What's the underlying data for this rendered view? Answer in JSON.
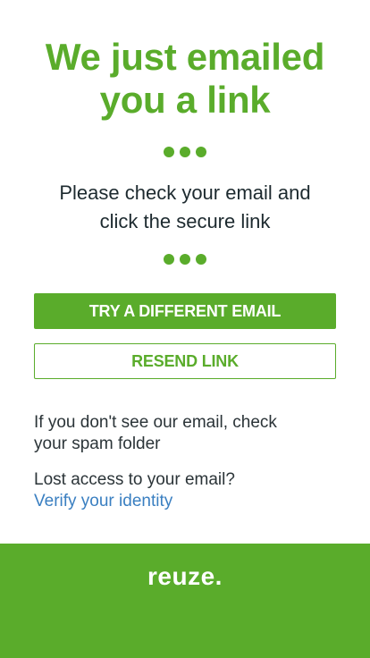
{
  "header": {
    "title_line1": "We just emailed",
    "title_line2": "you a link"
  },
  "message": {
    "line1": "Please check your email and",
    "line2": "click the secure link"
  },
  "buttons": {
    "try_different_email": "TRY A DIFFERENT EMAIL",
    "resend_link": "RESEND LINK"
  },
  "notes": {
    "spam_line1": "If you don't see our email, check",
    "spam_line2": "your spam folder",
    "lost_access": "Lost access to your email?",
    "verify_link": "Verify your identity"
  },
  "footer": {
    "logo_text": "reuze."
  },
  "colors": {
    "brand_green": "#5aac2b",
    "link_blue": "#3a7fc1",
    "text_dark": "#2b3438"
  }
}
